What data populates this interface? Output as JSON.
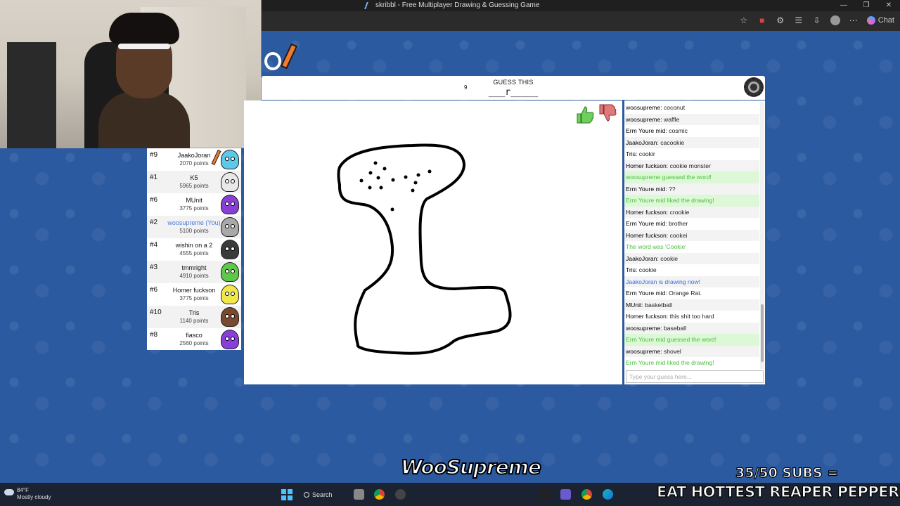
{
  "browser": {
    "window_title": "skribbl - Free Multiplayer Drawing & Guessing Game",
    "chat_label": "Chat"
  },
  "game": {
    "guess_label": "GUESS THIS",
    "word_hint": "___r_____",
    "hint_count": "9"
  },
  "players": [
    {
      "rank": "#9",
      "name": "JaakoJoran",
      "points": "2070 points",
      "avatar_color": "#5ec8e8",
      "drawing": true,
      "you": false
    },
    {
      "rank": "#1",
      "name": "K5",
      "points": "5965 points",
      "avatar_color": "#e8e8e8",
      "drawing": false,
      "you": false
    },
    {
      "rank": "#6",
      "name": "MUnit",
      "points": "3775 points",
      "avatar_color": "#8a3ed8",
      "drawing": false,
      "you": false
    },
    {
      "rank": "#2",
      "name": "woosupreme (You)",
      "points": "5100 points",
      "avatar_color": "#a8a8a8",
      "drawing": false,
      "you": true
    },
    {
      "rank": "#4",
      "name": "wishin on a 2",
      "points": "4555 points",
      "avatar_color": "#3a3a3a",
      "drawing": false,
      "you": false
    },
    {
      "rank": "#3",
      "name": "tmmright",
      "points": "4910 points",
      "avatar_color": "#5ec84a",
      "drawing": false,
      "you": false
    },
    {
      "rank": "#6",
      "name": "Homer fuckson",
      "points": "3775 points",
      "avatar_color": "#f0e84a",
      "drawing": false,
      "you": false
    },
    {
      "rank": "#10",
      "name": "Tris",
      "points": "1140 points",
      "avatar_color": "#7a4a2e",
      "drawing": false,
      "you": false
    },
    {
      "rank": "#8",
      "name": "fiasco",
      "points": "2560 points",
      "avatar_color": "#8a3ed8",
      "drawing": false,
      "you": false
    }
  ],
  "chat": {
    "messages": [
      {
        "type": "normal",
        "user": "woosupreme",
        "text": "coconut"
      },
      {
        "type": "normal",
        "user": "woosupreme",
        "text": "waffle"
      },
      {
        "type": "normal",
        "user": "Erm Youre mid",
        "text": "cosmic"
      },
      {
        "type": "normal",
        "user": "JaakoJoran",
        "text": "cacookie"
      },
      {
        "type": "normal",
        "user": "Tris",
        "text": "cookir"
      },
      {
        "type": "normal",
        "user": "Homer fuckson",
        "text": "cookie monster"
      },
      {
        "type": "green",
        "user": "",
        "text": "woosupreme guessed the word!"
      },
      {
        "type": "normal",
        "user": "Erm Youre mid",
        "text": "??"
      },
      {
        "type": "green",
        "user": "",
        "text": "Erm Youre mid liked the drawing!"
      },
      {
        "type": "normal",
        "user": "Homer fuckson",
        "text": "crookie"
      },
      {
        "type": "normal",
        "user": "Erm Youre mid",
        "text": "brother"
      },
      {
        "type": "normal",
        "user": "Homer fuckson",
        "text": "cookei"
      },
      {
        "type": "green-plain",
        "user": "",
        "text": "The word was 'Cookie'"
      },
      {
        "type": "normal",
        "user": "JaakoJoran",
        "text": "cookie"
      },
      {
        "type": "normal",
        "user": "Tris",
        "text": "cookie"
      },
      {
        "type": "blue",
        "user": "",
        "text": "JaakoJoran is drawing now!"
      },
      {
        "type": "normal",
        "user": "Erm Youre mid",
        "text": "Orange Rat."
      },
      {
        "type": "normal",
        "user": "MUnit",
        "text": "basketball"
      },
      {
        "type": "normal",
        "user": "Homer fuckson",
        "text": "this shit too hard"
      },
      {
        "type": "normal",
        "user": "woosupreme",
        "text": "baseball"
      },
      {
        "type": "green",
        "user": "",
        "text": "Erm Youre mid guessed the word!"
      },
      {
        "type": "normal",
        "user": "woosupreme",
        "text": "shovel"
      },
      {
        "type": "green-plain",
        "user": "",
        "text": "Erm Youre mid liked the drawing!"
      }
    ],
    "input_placeholder": "Type your guess here..."
  },
  "overlay": {
    "streamer_name": "WooSupreme",
    "subs_line1": "35/50 SUBS =",
    "subs_line2": "EAT HOTTEST REAPER PEPPER"
  },
  "taskbar": {
    "temperature": "84°F",
    "weather": "Mostly cloudy",
    "search_label": "Search"
  },
  "colors": {
    "page_bg": "#2c5aa0",
    "guess_green": "#4bbf3e",
    "system_blue": "#3a6fd8"
  }
}
